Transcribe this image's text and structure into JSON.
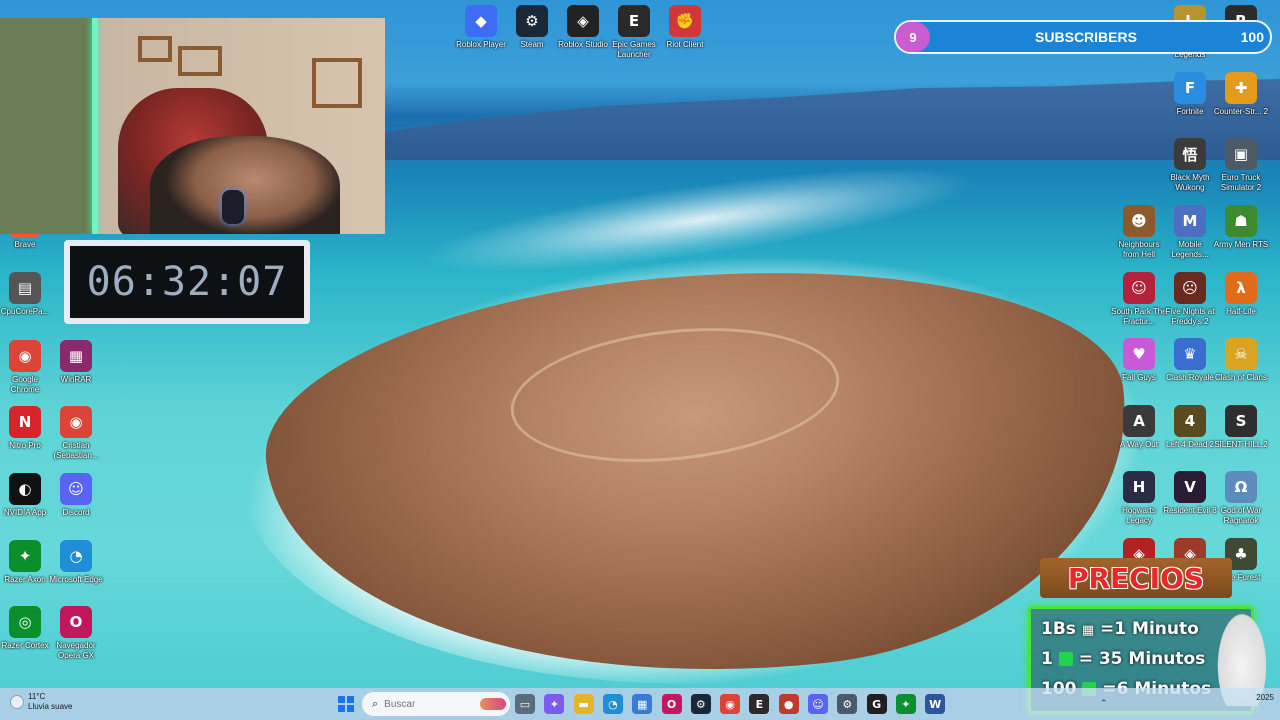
{
  "desktop_icons_top": [
    {
      "name": "roblox-player-icon",
      "label": "Roblox Player",
      "glyph": "◆",
      "color": "#3d6df5"
    },
    {
      "name": "steam-icon",
      "label": "Steam",
      "glyph": "⚙",
      "color": "#1b2838"
    },
    {
      "name": "roblox-studio-icon",
      "label": "Roblox Studio",
      "glyph": "◈",
      "color": "#222222"
    },
    {
      "name": "epic-games-icon",
      "label": "Epic Games Launcher",
      "glyph": "E",
      "color": "#2a2a2a"
    },
    {
      "name": "riot-client-icon",
      "label": "Riot Client",
      "glyph": "✊",
      "color": "#d13639"
    }
  ],
  "desktop_icons_left": [
    {
      "name": "brave-icon",
      "label": "Brave",
      "glyph": "🦁",
      "color": "#fb542b"
    },
    {
      "name": "cpu-core-park-icon",
      "label": "CpuCorePa...",
      "glyph": "▤",
      "color": "#555555"
    },
    {
      "name": "google-chrome-icon",
      "label": "Google Chrome",
      "glyph": "◉",
      "color": "#db4437"
    },
    {
      "name": "winrar-icon",
      "label": "WinRAR",
      "glyph": "▦",
      "color": "#8b2a6a"
    },
    {
      "name": "nitro-pro-icon",
      "label": "Nitro Pro",
      "glyph": "N",
      "color": "#d7242b"
    },
    {
      "name": "cristian-chrome-profile-icon",
      "label": "Cristian (Sebastian...",
      "glyph": "◉",
      "color": "#db4437"
    },
    {
      "name": "nvidia-app-icon",
      "label": "NVIDIA App",
      "glyph": "◐",
      "color": "#111111"
    },
    {
      "name": "discord-icon",
      "label": "Discord",
      "glyph": "☺",
      "color": "#5865f2"
    },
    {
      "name": "razer-axon-icon",
      "label": "Razer Axon",
      "glyph": "✦",
      "color": "#0a8f2c"
    },
    {
      "name": "microsoft-edge-icon",
      "label": "Microsoft Edge",
      "glyph": "◔",
      "color": "#1e8fd6"
    },
    {
      "name": "razer-cortex-icon",
      "label": "Razer Cortex",
      "glyph": "◎",
      "color": "#0a8f2c"
    },
    {
      "name": "opera-gx-icon",
      "label": "Navegador Opera GX",
      "glyph": "O",
      "color": "#c2185b"
    }
  ],
  "desktop_icons_right": [
    {
      "name": "league-of-legends-icon",
      "label": "League of Legends",
      "glyph": "L",
      "color": "#b8932e"
    },
    {
      "name": "resident-evil-icon",
      "label": "Resident Evil",
      "glyph": "R",
      "color": "#2b2b2b"
    },
    {
      "name": "fortnite-icon",
      "label": "Fortnite",
      "glyph": "F",
      "color": "#2b8de0"
    },
    {
      "name": "counter-strike-icon",
      "label": "Counter-Str... 2",
      "glyph": "✚",
      "color": "#e49a1d"
    },
    {
      "name": "black-myth-wukong-icon",
      "label": "Black Myth Wukong",
      "glyph": "悟",
      "color": "#3b3b3b"
    },
    {
      "name": "euro-truck-simulator-icon",
      "label": "Euro Truck Simulator 2",
      "glyph": "▣",
      "color": "#4d5a66"
    },
    {
      "name": "neighbours-from-hell-icon",
      "label": "Neighbours from Hell",
      "glyph": "☻",
      "color": "#8e5a2d"
    },
    {
      "name": "mobile-legends-icon",
      "label": "Mobile Legends...",
      "glyph": "M",
      "color": "#4d6ec2"
    },
    {
      "name": "army-men-rts-icon",
      "label": "Army Men RTS",
      "glyph": "☗",
      "color": "#3d8b2f"
    },
    {
      "name": "south-park-icon",
      "label": "South Park The Fractur...",
      "glyph": "☺",
      "color": "#b3223a"
    },
    {
      "name": "five-nights-at-freddys-icon",
      "label": "Five Nights at Freddy's 2",
      "glyph": "☹",
      "color": "#6b2a1e"
    },
    {
      "name": "half-life-icon",
      "label": "Half-Life",
      "glyph": "λ",
      "color": "#e06b1a"
    },
    {
      "name": "fall-guys-icon",
      "label": "Fall Guys",
      "glyph": "♥",
      "color": "#c85ad8"
    },
    {
      "name": "clash-royale-icon",
      "label": "Clash Royale",
      "glyph": "♛",
      "color": "#3a6dd0"
    },
    {
      "name": "clash-of-clans-icon",
      "label": "Clash of Clans",
      "glyph": "☠",
      "color": "#d9a420"
    },
    {
      "name": "a-way-out-icon",
      "label": "A Way Out",
      "glyph": "A",
      "color": "#3a3a3a"
    },
    {
      "name": "left-4-dead-2-icon",
      "label": "Left 4 Dead 2",
      "glyph": "4",
      "color": "#5a4a20"
    },
    {
      "name": "silent-hill-2-icon",
      "label": "SILENT HILL 2",
      "glyph": "S",
      "color": "#2e2e2e"
    },
    {
      "name": "hogwarts-legacy-icon",
      "label": "Hogwarts Legacy",
      "glyph": "H",
      "color": "#2a2d44"
    },
    {
      "name": "resident-evil-8-icon",
      "label": "Resident Evil 8",
      "glyph": "V",
      "color": "#2a1d33"
    },
    {
      "name": "god-of-war-ragnarok-icon",
      "label": "God of War Ragnarok",
      "glyph": "Ω",
      "color": "#5c8bbd"
    },
    {
      "name": "game-icon-row8-a",
      "label": "",
      "glyph": "◈",
      "color": "#b22222"
    },
    {
      "name": "game-icon-row8-b",
      "label": "",
      "glyph": "◈",
      "color": "#9c3b2a"
    },
    {
      "name": "the-forest-icon",
      "label": "The Forest",
      "glyph": "♣",
      "color": "#3f4a35"
    }
  ],
  "webcam": {
    "label": "webcam-feed"
  },
  "timer": {
    "value": "06:32:07"
  },
  "subscribers": {
    "count": "9",
    "label": "SUBSCRIBERS",
    "goal": "100",
    "progress": 0.09
  },
  "precios": {
    "title": "PRECIOS",
    "rows": [
      {
        "amount": "1Bs",
        "equals": "=1 Minuto"
      },
      {
        "amount": "1",
        "equals": "= 35 Minutos"
      },
      {
        "amount": "100",
        "equals": "=6 Minutos"
      }
    ]
  },
  "taskbar": {
    "weather_temp": "11°C",
    "weather_desc": "Lluvia suave",
    "search_placeholder": "Buscar",
    "apps": [
      {
        "name": "task-view-icon",
        "glyph": "▭",
        "color": "#5a6b7a"
      },
      {
        "name": "copilot-icon",
        "glyph": "✦",
        "color": "#7a5cf0"
      },
      {
        "name": "file-explorer-icon",
        "glyph": "▬",
        "color": "#e6b427"
      },
      {
        "name": "edge-taskbar-icon",
        "glyph": "◔",
        "color": "#1e8fd6"
      },
      {
        "name": "microsoft-store-icon",
        "glyph": "▦",
        "color": "#3a7bd5"
      },
      {
        "name": "opera-gx-taskbar-icon",
        "glyph": "O",
        "color": "#c2185b"
      },
      {
        "name": "steam-taskbar-icon",
        "glyph": "⚙",
        "color": "#1b2838"
      },
      {
        "name": "chrome-taskbar-icon",
        "glyph": "◉",
        "color": "#db4437"
      },
      {
        "name": "epic-taskbar-icon",
        "glyph": "E",
        "color": "#2a2a2a"
      },
      {
        "name": "obs-taskbar-icon",
        "glyph": "●",
        "color": "#c0392b"
      },
      {
        "name": "discord-taskbar-icon",
        "glyph": "☺",
        "color": "#5865f2"
      },
      {
        "name": "settings-taskbar-icon",
        "glyph": "⚙",
        "color": "#4a5a6a"
      },
      {
        "name": "g-hub-taskbar-icon",
        "glyph": "G",
        "color": "#1f1f1f"
      },
      {
        "name": "razer-taskbar-icon",
        "glyph": "✦",
        "color": "#0a8f2c"
      },
      {
        "name": "word-taskbar-icon",
        "glyph": "W",
        "color": "#2b579a"
      }
    ],
    "clock_year": "2025"
  }
}
